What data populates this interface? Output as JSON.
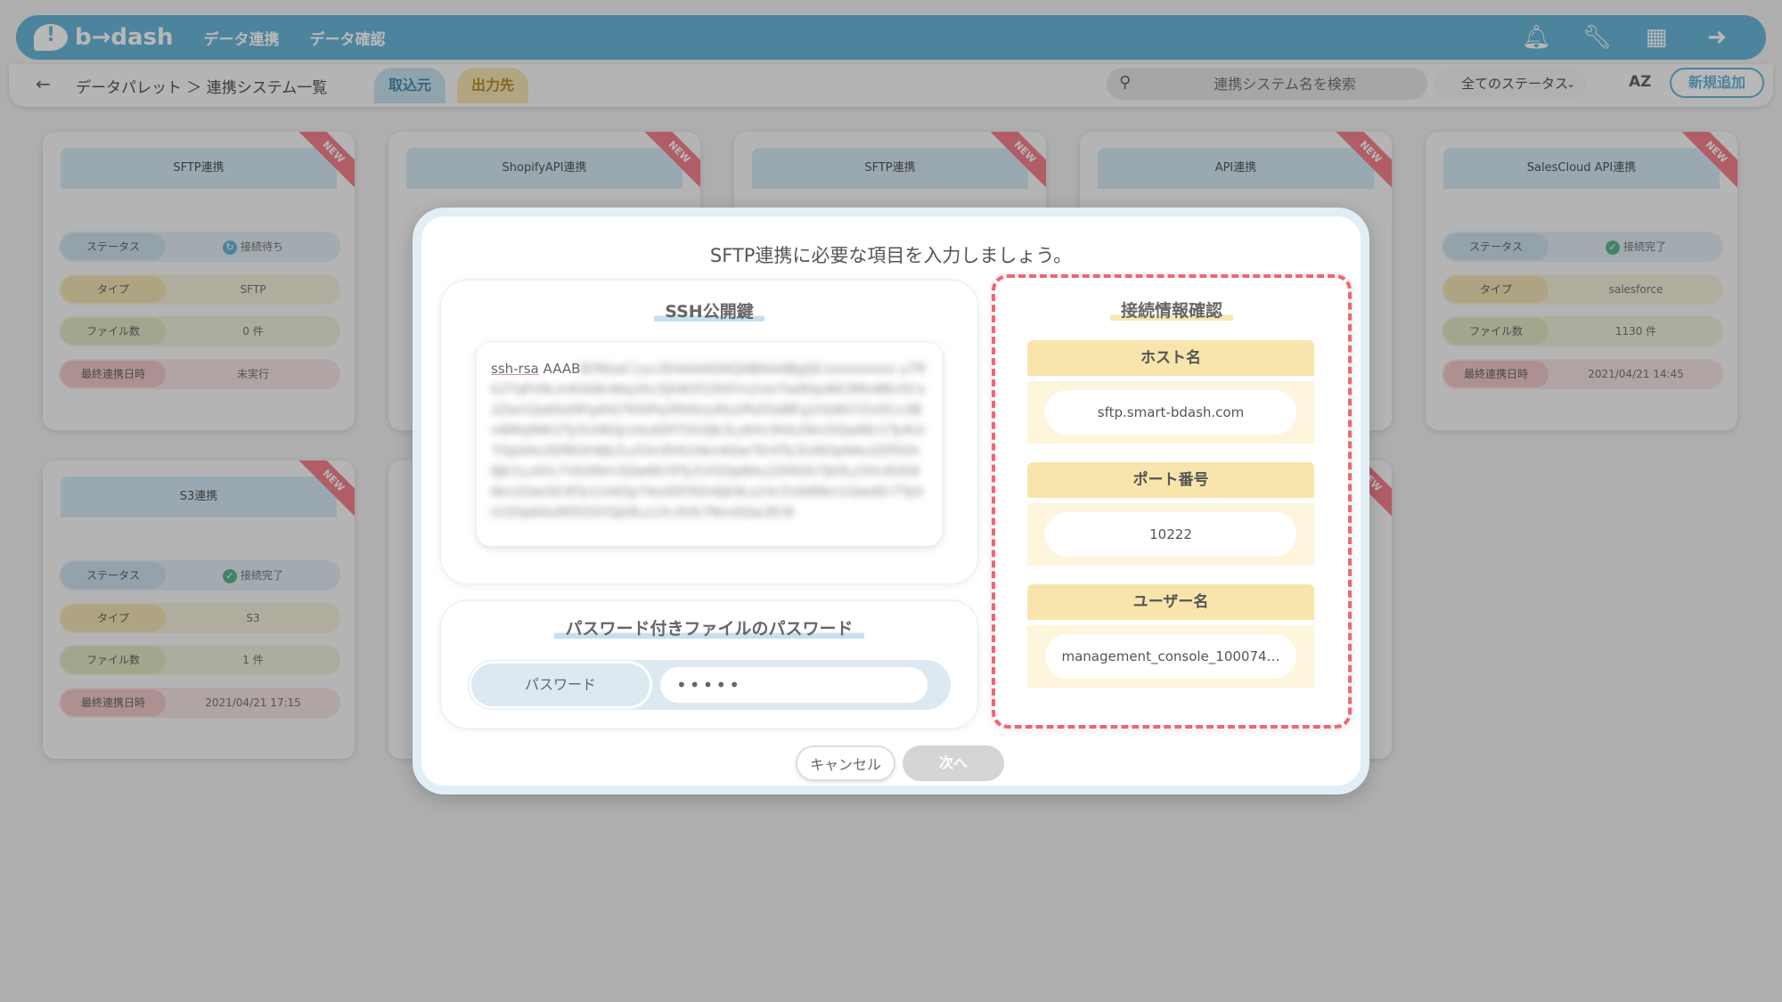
{
  "app": {
    "logo": "b→dash",
    "nav": [
      "データ連携",
      "データ確認"
    ]
  },
  "subbar": {
    "breadcrumb": "データパレット ＞ 連携システム一覧",
    "tab_import": "取込元",
    "tab_export": "出力先",
    "search_placeholder": "連携システム名を検索",
    "status_filter": "全てのステータス",
    "sort_label": "AZ",
    "new_button": "新規追加"
  },
  "cards": [
    {
      "title": "SFTP連携",
      "badge": "NEW",
      "status_label": "ステータス",
      "status": "接続待ち",
      "type_label": "タイプ",
      "type": "SFTP",
      "files_label": "ファイル数",
      "files": "0 件",
      "last_label": "最終連携日時",
      "last": "未実行"
    },
    {
      "title": "ShopifyAPI連携",
      "badge": "NEW"
    },
    {
      "title": "SFTP連携",
      "badge": "NEW"
    },
    {
      "title": "API連携",
      "badge": "NEW"
    },
    {
      "title": "SalesCloud API連携",
      "badge": "NEW",
      "status_label": "ステータス",
      "status": "接続完了",
      "type_label": "タイプ",
      "type": "salesforce",
      "files_label": "ファイル数",
      "files": "1130 件",
      "last_label": "最終連携日時",
      "last": "2021/04/21 14:45"
    },
    {
      "title": "S3連携",
      "badge": "NEW",
      "status_label": "ステータス",
      "status": "接続完了",
      "type_label": "タイプ",
      "type": "S3",
      "files_label": "ファイル数",
      "files": "1 件",
      "last_label": "最終連携日時",
      "last": "2021/04/21 17:15"
    }
  ],
  "modal": {
    "title": "SFTP連携に必要な項目を入力しましょう。",
    "ssh_section": "SSH公開鍵",
    "ssh_key_prefix": "ssh-rsa",
    "ssh_key_start": "AAAB",
    "password_section": "パスワード付きファイルのパスワード",
    "password_label": "パスワード",
    "password_value": "•••••",
    "connection_section": "接続情報確認",
    "host_label": "ホスト名",
    "host_value": "sftp.smart-bdash.com",
    "port_label": "ポート番号",
    "port_value": "10222",
    "user_label": "ユーザー名",
    "user_value": "management_console_100074…",
    "cancel": "キャンセル",
    "next": "次へ"
  },
  "colors": {
    "accent": "#6ab7da",
    "highlight_dash": "#f4646f"
  }
}
